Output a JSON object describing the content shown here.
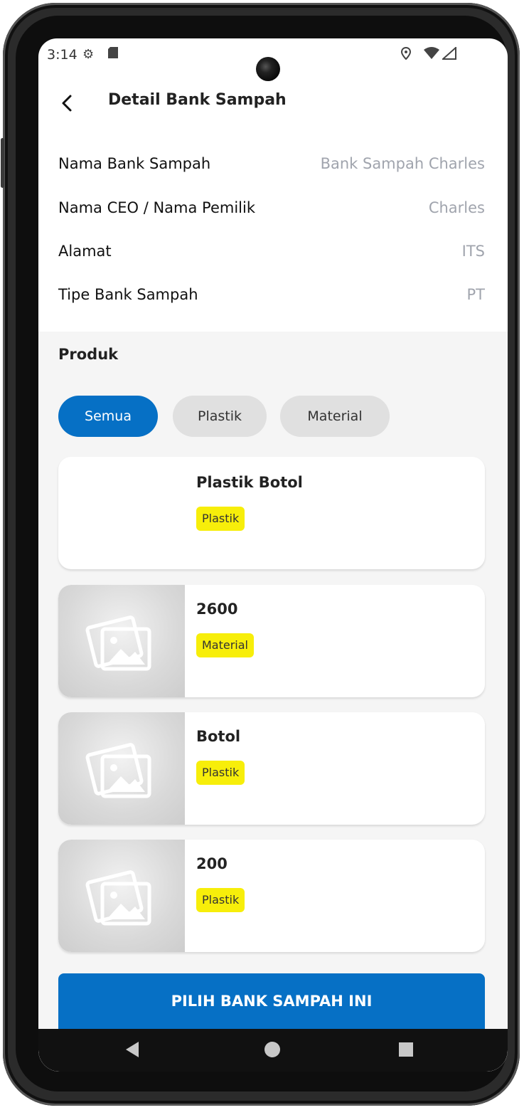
{
  "status_bar": {
    "time": "3:14",
    "icons": [
      "settings-icon",
      "sd-card-icon",
      "location-icon",
      "wifi-icon",
      "signal-icon"
    ]
  },
  "app_bar": {
    "back_icon": "chevron-left-icon",
    "title": "Detail Bank Sampah"
  },
  "details": [
    {
      "label": "Nama Bank Sampah",
      "value": "Bank Sampah Charles"
    },
    {
      "label": "Nama CEO / Nama Pemilik",
      "value": "Charles"
    },
    {
      "label": "Alamat",
      "value": "ITS"
    },
    {
      "label": "Tipe Bank Sampah",
      "value": "PT"
    }
  ],
  "products": {
    "title": "Produk",
    "filters": [
      {
        "label": "Semua",
        "active": true
      },
      {
        "label": "Plastik",
        "active": false
      },
      {
        "label": "Material",
        "active": false
      }
    ],
    "items": [
      {
        "name": "Plastik Botol",
        "category": "Plastik",
        "has_image_placeholder": false
      },
      {
        "name": "2600",
        "category": "Material",
        "has_image_placeholder": true
      },
      {
        "name": "Botol",
        "category": "Plastik",
        "has_image_placeholder": true
      },
      {
        "name": "200",
        "category": "Plastik",
        "has_image_placeholder": true
      }
    ]
  },
  "action_button": "PILIH BANK SAMPAH INI",
  "colors": {
    "primary": "#0670c5",
    "badge": "#f7ee0a",
    "chip_inactive": "#e0e0e0",
    "value_text": "#a0a4ad",
    "section_bg": "#f5f5f5"
  },
  "nav_bar": {
    "icons": [
      "nav-back-icon",
      "nav-home-icon",
      "nav-recents-icon"
    ]
  }
}
